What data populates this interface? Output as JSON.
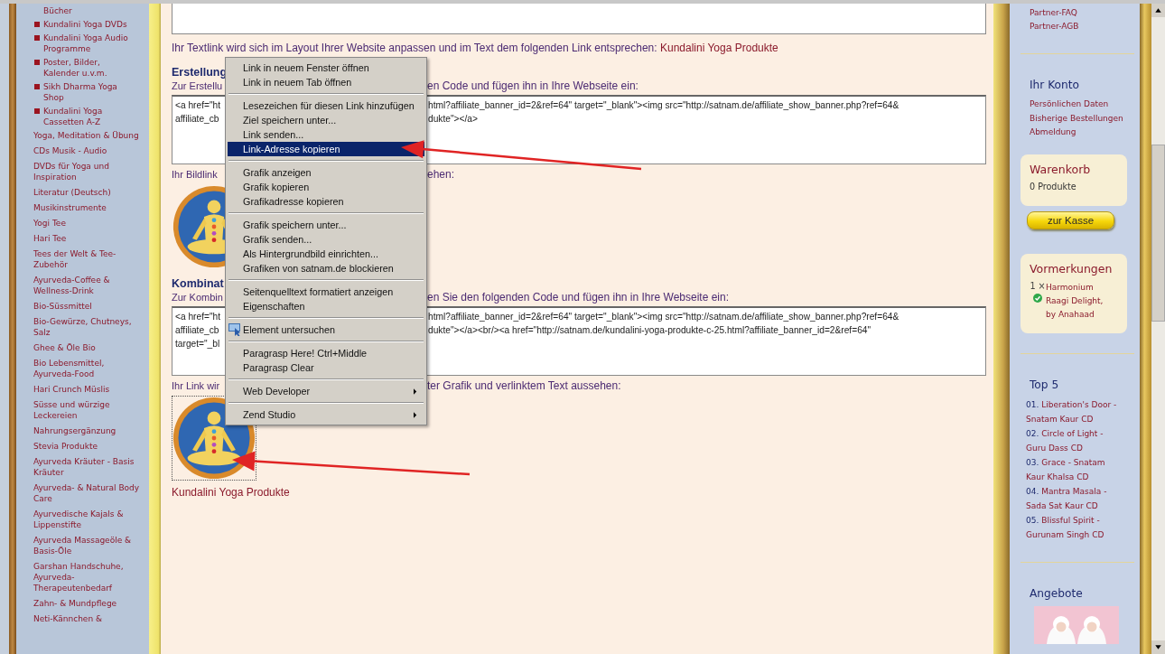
{
  "left_sidebar": {
    "items": [
      {
        "label": "Bücher",
        "kind": "continuation"
      },
      {
        "label": "Kundalini Yoga DVDs",
        "kind": "subcategory"
      },
      {
        "label": "Kundalini Yoga Audio Programme",
        "kind": "subcategory"
      },
      {
        "label": "Poster, Bilder, Kalender u.v.m.",
        "kind": "subcategory"
      },
      {
        "label": "Sikh Dharma Yoga Shop",
        "kind": "subcategory"
      },
      {
        "label": "Kundalini Yoga Cassetten A-Z",
        "kind": "subcategory"
      },
      {
        "label": "Yoga, Meditation & Übung",
        "kind": "category"
      },
      {
        "label": "CDs Musik - Audio",
        "kind": "category"
      },
      {
        "label": "DVDs für Yoga und Inspiration",
        "kind": "category"
      },
      {
        "label": "Literatur (Deutsch)",
        "kind": "category"
      },
      {
        "label": "Musikinstrumente",
        "kind": "category"
      },
      {
        "label": "Yogi Tee",
        "kind": "category"
      },
      {
        "label": "Hari Tee",
        "kind": "category"
      },
      {
        "label": "Tees der Welt & Tee-Zubehör",
        "kind": "category"
      },
      {
        "label": "Ayurveda-Coffee & Wellness-Drink",
        "kind": "category"
      },
      {
        "label": "Bio-Süssmittel",
        "kind": "category"
      },
      {
        "label": "Bio-Gewürze, Chutneys, Salz",
        "kind": "category"
      },
      {
        "label": "Ghee & Öle Bio",
        "kind": "category"
      },
      {
        "label": "Bio Lebensmittel, Ayurveda-Food",
        "kind": "category"
      },
      {
        "label": "Hari Crunch Müslis",
        "kind": "category"
      },
      {
        "label": "Süsse und würzige Leckereien",
        "kind": "category"
      },
      {
        "label": "Nahrungsergänzung",
        "kind": "category"
      },
      {
        "label": "Stevia Produkte",
        "kind": "category"
      },
      {
        "label": "Ayurveda Kräuter - Basis Kräuter",
        "kind": "category"
      },
      {
        "label": "Ayurveda- & Natural Body Care",
        "kind": "category"
      },
      {
        "label": "Ayurvedische Kajals & Lippenstifte",
        "kind": "category"
      },
      {
        "label": "Ayurveda Massageöle & Basis-Öle",
        "kind": "category"
      },
      {
        "label": "Garshan Handschuhe, Ayurveda-Therapeutenbedarf",
        "kind": "category"
      },
      {
        "label": "Zahn- & Mundpflege",
        "kind": "category"
      },
      {
        "label": "Neti-Kännchen &",
        "kind": "category"
      }
    ]
  },
  "main": {
    "textlink_note": {
      "text": "Ihr Textlink wird sich im Layout Ihrer Website anpassen und im Text dem folgenden Link entsprechen:",
      "link": "Kundalini Yoga Produkte"
    },
    "sections": [
      {
        "heading": "Erstellung",
        "instruction_left": "Zur Erstellu",
        "instruction_right": "en Code und fügen ihn in Ihre Webseite ein:",
        "code_lines": [
          {
            "left": "<a href=\"ht",
            "right": "html?affiliate_banner_id=2&ref=64\" target=\"_blank\"><img src=\"http://satnam.de/affiliate_show_banner.php?ref=64&"
          },
          {
            "left": "affiliate_cb",
            "right": "dukte\"></a>"
          }
        ],
        "preview_left": "Ihr Bildlink",
        "preview_right": "ehen:",
        "preview": {
          "kind": "picture",
          "focused": false
        }
      },
      {
        "heading": "Kombinat",
        "instruction_left": "Zur Kombin",
        "instruction_right": "en Sie den folgenden Code und fügen ihn in Ihre Webseite ein:",
        "code_lines": [
          {
            "left": "<a href=\"ht",
            "right": "html?affiliate_banner_id=2&ref=64\" target=\"_blank\"><img src=\"http://satnam.de/affiliate_show_banner.php?ref=64&"
          },
          {
            "left": "affiliate_cb",
            "right": "dukte\"></a><br/><a href=\"http://satnam.de/kundalini-yoga-produkte-c-25.html?affiliate_banner_id=2&ref=64\""
          },
          {
            "left": "target=\"_bl"
          }
        ],
        "preview_left": "Ihr Link wir",
        "preview_right": "ter Grafik und verlinktem Text aussehen:",
        "preview": {
          "kind": "picture",
          "focused": true
        },
        "caption": "Kundalini Yoga Produkte"
      }
    ]
  },
  "context_menu": {
    "groups": [
      {
        "items": [
          {
            "label": "Link in neuem Fenster öffnen",
            "kind": "plain",
            "selected": false
          },
          {
            "label": "Link in neuem Tab öffnen",
            "kind": "plain",
            "selected": false
          }
        ]
      },
      {
        "items": [
          {
            "label": "Lesezeichen für diesen Link hinzufügen",
            "kind": "plain",
            "selected": false
          },
          {
            "label": "Ziel speichern unter...",
            "kind": "plain",
            "selected": false
          },
          {
            "label": "Link senden...",
            "kind": "plain",
            "selected": false
          },
          {
            "label": "Link-Adresse kopieren",
            "kind": "plain",
            "selected": true
          }
        ]
      },
      {
        "items": [
          {
            "label": "Grafik anzeigen",
            "kind": "plain",
            "selected": false
          },
          {
            "label": "Grafik kopieren",
            "kind": "plain",
            "selected": false
          },
          {
            "label": "Grafikadresse kopieren",
            "kind": "plain",
            "selected": false
          }
        ]
      },
      {
        "items": [
          {
            "label": "Grafik speichern unter...",
            "kind": "plain",
            "selected": false
          },
          {
            "label": "Grafik senden...",
            "kind": "plain",
            "selected": false
          },
          {
            "label": "Als Hintergrundbild einrichten...",
            "kind": "plain",
            "selected": false
          },
          {
            "label": "Grafiken von satnam.de blockieren",
            "kind": "plain",
            "selected": false
          }
        ]
      },
      {
        "items": [
          {
            "label": "Seitenquelltext formatiert anzeigen",
            "kind": "plain",
            "selected": false
          },
          {
            "label": "Eigenschaften",
            "kind": "plain",
            "selected": false
          }
        ]
      },
      {
        "items": [
          {
            "label": "Element untersuchen",
            "kind": "with_icon",
            "selected": false
          }
        ]
      },
      {
        "items": [
          {
            "label": "Paragrasp Here! Ctrl+Middle",
            "kind": "plain",
            "selected": false
          },
          {
            "label": "Paragrasp Clear",
            "kind": "plain",
            "selected": false
          }
        ]
      },
      {
        "items": [
          {
            "label": "Web Developer",
            "kind": "submenu",
            "selected": false
          }
        ]
      },
      {
        "items": [
          {
            "label": "Zend Studio",
            "kind": "submenu",
            "selected": false
          }
        ]
      }
    ]
  },
  "right_sidebar": {
    "partner_links": [
      "Partner-FAQ",
      "Partner-AGB"
    ],
    "account": {
      "title": "Ihr Konto",
      "links": [
        "Persönlichen Daten",
        "Bisherige Bestellungen",
        "Abmeldung"
      ]
    },
    "cart": {
      "title": "Warenkorb",
      "count": "0 Produkte",
      "checkout_button": "zur Kasse"
    },
    "watchlist": {
      "title": "Vormerkungen",
      "items": [
        {
          "quantity": "1 ×",
          "name": "Harmonium Raagi Delight, by Anahaad",
          "available": true
        }
      ]
    },
    "top5": {
      "title": "Top 5",
      "items": [
        {
          "rank": "01.",
          "title": "Liberation's Door - Snatam Kaur CD"
        },
        {
          "rank": "02.",
          "title": "Circle of Light - Guru Dass CD"
        },
        {
          "rank": "03.",
          "title": "Grace - Snatam Kaur Khalsa CD"
        },
        {
          "rank": "04.",
          "title": "Mantra Masala - Sada Sat Kaur CD"
        },
        {
          "rank": "05.",
          "title": "Blissful Spirit - Gurunam Singh CD"
        }
      ]
    },
    "offers": {
      "title": "Angebote",
      "picture": {
        "kind": "picture"
      }
    }
  }
}
